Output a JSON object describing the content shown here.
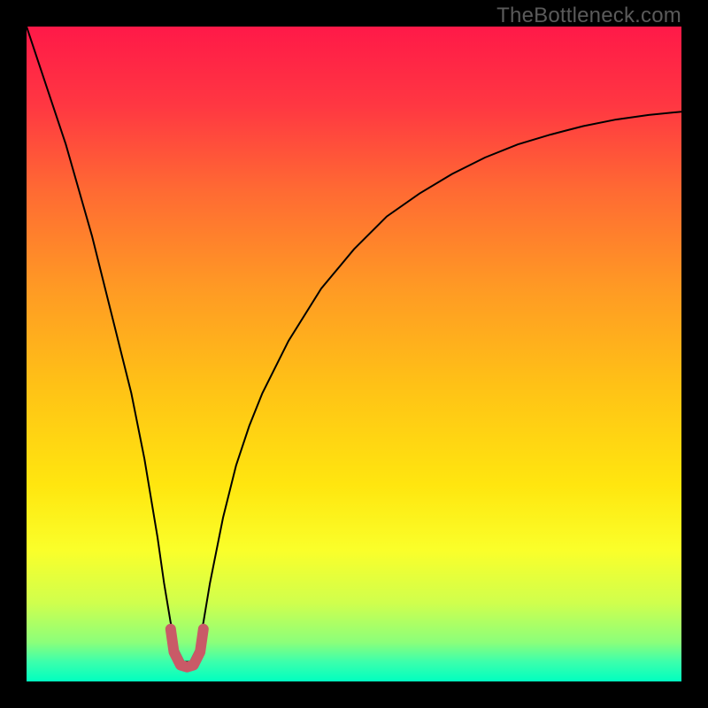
{
  "watermark": "TheBottleneck.com",
  "chart_data": {
    "type": "line",
    "title": "",
    "xlabel": "",
    "ylabel": "",
    "xlim": [
      0,
      100
    ],
    "ylim": [
      0,
      100
    ],
    "legend": false,
    "grid": false,
    "background_gradient": {
      "stops": [
        {
          "offset": 0.0,
          "color": "#ff1948"
        },
        {
          "offset": 0.12,
          "color": "#ff3742"
        },
        {
          "offset": 0.25,
          "color": "#ff6a33"
        },
        {
          "offset": 0.4,
          "color": "#ff9a24"
        },
        {
          "offset": 0.55,
          "color": "#ffc216"
        },
        {
          "offset": 0.7,
          "color": "#ffe60f"
        },
        {
          "offset": 0.8,
          "color": "#faff2a"
        },
        {
          "offset": 0.88,
          "color": "#d0ff4d"
        },
        {
          "offset": 0.94,
          "color": "#8cff7a"
        },
        {
          "offset": 0.97,
          "color": "#3cffac"
        },
        {
          "offset": 1.0,
          "color": "#00ffc0"
        }
      ]
    },
    "series": [
      {
        "name": "bottleneck-curve",
        "color": "#000000",
        "width": 2,
        "x": [
          0,
          2,
          4,
          6,
          8,
          10,
          12,
          14,
          16,
          18,
          20,
          21,
          22,
          23,
          24,
          25,
          26,
          27,
          28,
          30,
          32,
          34,
          36,
          40,
          45,
          50,
          55,
          60,
          65,
          70,
          75,
          80,
          85,
          90,
          95,
          100
        ],
        "y": [
          100,
          94,
          88,
          82,
          75,
          68,
          60,
          52,
          44,
          34,
          22,
          15,
          9,
          5,
          3,
          3,
          5,
          9,
          15,
          25,
          33,
          39,
          44,
          52,
          60,
          66,
          71,
          74.5,
          77.5,
          80,
          82,
          83.5,
          84.8,
          85.8,
          86.5,
          87
        ]
      },
      {
        "name": "optimal-marker",
        "color": "#c95a67",
        "width": 12,
        "linecap": "round",
        "x": [
          22.0,
          22.5,
          23.5,
          24.5,
          25.5,
          26.5,
          27.0
        ],
        "y": [
          8.0,
          4.5,
          2.5,
          2.2,
          2.5,
          4.5,
          8.0
        ]
      }
    ]
  }
}
